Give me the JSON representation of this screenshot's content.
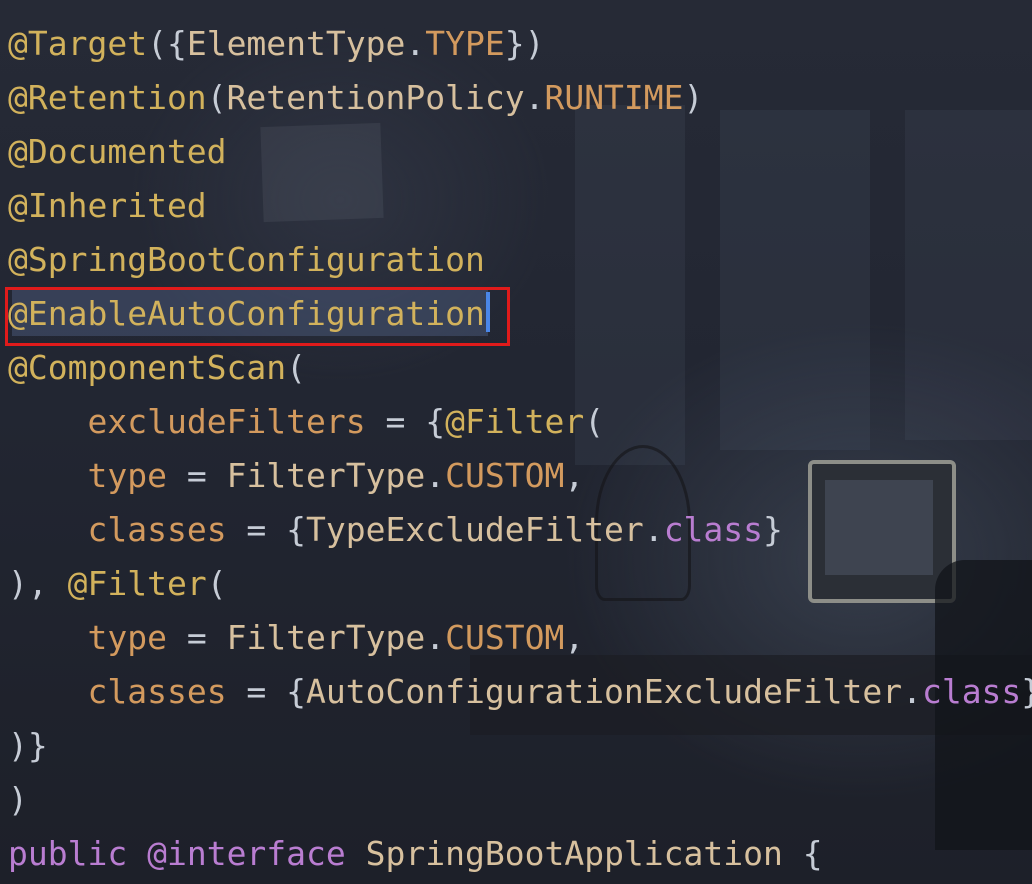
{
  "editor": {
    "lines": [
      [
        {
          "t": "@Target",
          "c": "ann"
        },
        {
          "t": "({",
          "c": "punc"
        },
        {
          "t": "ElementType",
          "c": "cls"
        },
        {
          "t": ".",
          "c": "punc"
        },
        {
          "t": "TYPE",
          "c": "enumv"
        },
        {
          "t": "})",
          "c": "punc"
        }
      ],
      [
        {
          "t": "@Retention",
          "c": "ann"
        },
        {
          "t": "(",
          "c": "punc"
        },
        {
          "t": "RetentionPolicy",
          "c": "cls"
        },
        {
          "t": ".",
          "c": "punc"
        },
        {
          "t": "RUNTIME",
          "c": "enumv"
        },
        {
          "t": ")",
          "c": "punc"
        }
      ],
      [
        {
          "t": "@Documented",
          "c": "ann"
        }
      ],
      [
        {
          "t": "@Inherited",
          "c": "ann"
        }
      ],
      [
        {
          "t": "@SpringBootConfiguration",
          "c": "ann"
        }
      ],
      [
        {
          "t": "@EnableAutoConfiguration",
          "c": "ann"
        }
      ],
      [
        {
          "t": "@ComponentScan",
          "c": "ann"
        },
        {
          "t": "(",
          "c": "punc"
        }
      ],
      [
        {
          "t": "    ",
          "c": "punc"
        },
        {
          "t": "excludeFilters",
          "c": "param"
        },
        {
          "t": " = {",
          "c": "punc"
        },
        {
          "t": "@Filter",
          "c": "ann"
        },
        {
          "t": "(",
          "c": "punc"
        }
      ],
      [
        {
          "t": "    ",
          "c": "punc"
        },
        {
          "t": "type",
          "c": "param"
        },
        {
          "t": " = ",
          "c": "punc"
        },
        {
          "t": "FilterType",
          "c": "cls"
        },
        {
          "t": ".",
          "c": "punc"
        },
        {
          "t": "CUSTOM",
          "c": "enumv"
        },
        {
          "t": ",",
          "c": "punc"
        }
      ],
      [
        {
          "t": "    ",
          "c": "punc"
        },
        {
          "t": "classes",
          "c": "param"
        },
        {
          "t": " = {",
          "c": "punc"
        },
        {
          "t": "TypeExcludeFilter",
          "c": "cls"
        },
        {
          "t": ".",
          "c": "punc"
        },
        {
          "t": "class",
          "c": "kw"
        },
        {
          "t": "}",
          "c": "punc"
        }
      ],
      [
        {
          "t": "), ",
          "c": "punc"
        },
        {
          "t": "@Filter",
          "c": "ann"
        },
        {
          "t": "(",
          "c": "punc"
        }
      ],
      [
        {
          "t": "    ",
          "c": "punc"
        },
        {
          "t": "type",
          "c": "param"
        },
        {
          "t": " = ",
          "c": "punc"
        },
        {
          "t": "FilterType",
          "c": "cls"
        },
        {
          "t": ".",
          "c": "punc"
        },
        {
          "t": "CUSTOM",
          "c": "enumv"
        },
        {
          "t": ",",
          "c": "punc"
        }
      ],
      [
        {
          "t": "    ",
          "c": "punc"
        },
        {
          "t": "classes",
          "c": "param"
        },
        {
          "t": " = {",
          "c": "punc"
        },
        {
          "t": "AutoConfigurationExcludeFilter",
          "c": "cls"
        },
        {
          "t": ".",
          "c": "punc"
        },
        {
          "t": "class",
          "c": "kw"
        },
        {
          "t": "}",
          "c": "punc"
        }
      ],
      [
        {
          "t": ")}",
          "c": "punc"
        }
      ],
      [
        {
          "t": ")",
          "c": "punc"
        }
      ],
      [
        {
          "t": "public",
          "c": "kw"
        },
        {
          "t": " ",
          "c": "punc"
        },
        {
          "t": "@interface",
          "c": "kw"
        },
        {
          "t": " ",
          "c": "punc"
        },
        {
          "t": "SpringBootApplication",
          "c": "ident"
        },
        {
          "t": " {",
          "c": "punc"
        }
      ]
    ],
    "highlighted_line_index": 5
  },
  "colors": {
    "annotation": "#d2b25c",
    "class_name": "#d7c09e",
    "enum_constant": "#d39a5e",
    "keyword": "#b97dd1",
    "punctuation": "#c6ccd6",
    "highlight_border": "#e01b1b",
    "caret": "#4a86e8",
    "background": "#232733"
  }
}
